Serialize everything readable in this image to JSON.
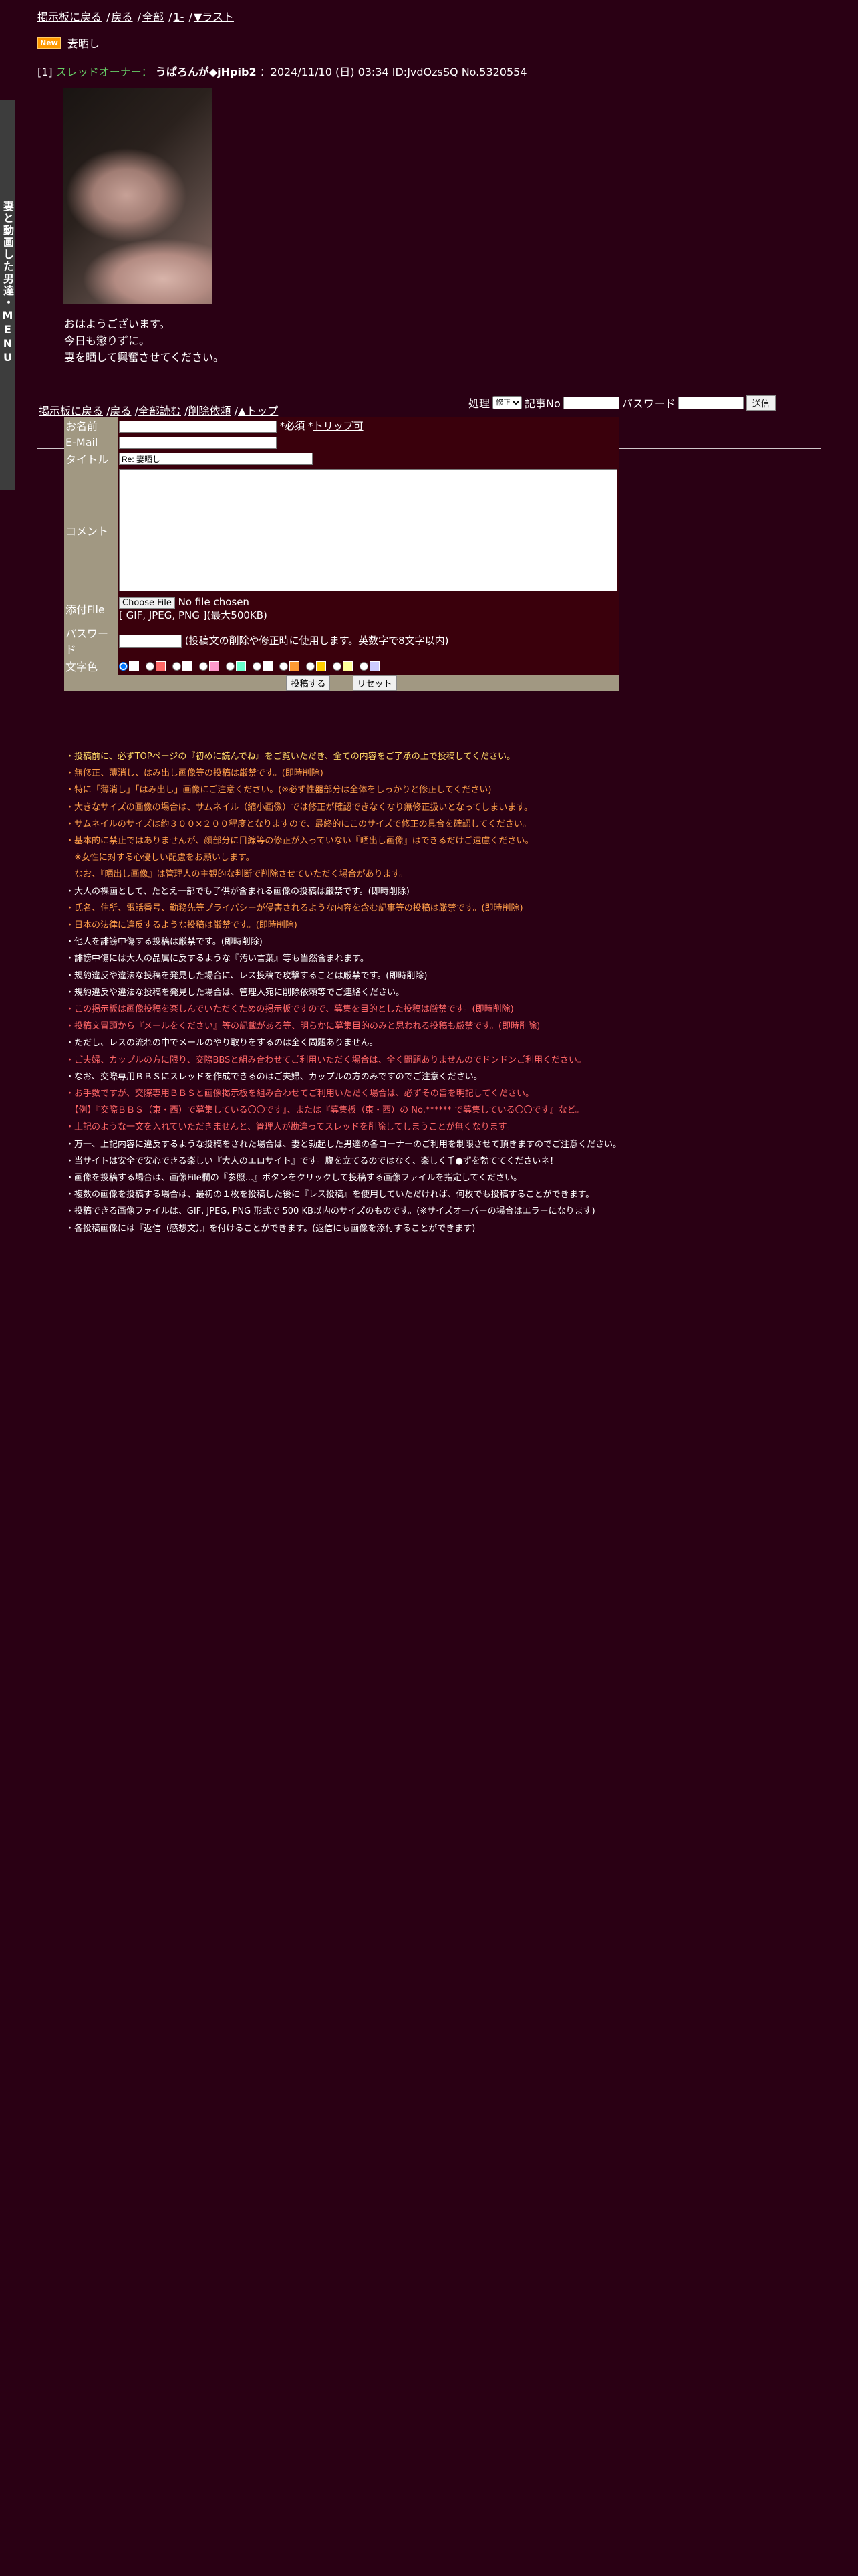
{
  "side_menu": {
    "label": "妻と動画した男達・MENU"
  },
  "topnav": {
    "back_board": "掲示板に戻る",
    "back": "戻る",
    "all": "全部",
    "first": "1-",
    "last": "▼ラスト"
  },
  "thread": {
    "new_badge": "New",
    "title": "妻晒し"
  },
  "post": {
    "number": "[1]",
    "owner_label": "スレッドオーナー：",
    "name": "うぱろんが◆jHpib2",
    "meta": "：2024/11/10 (日) 03:34 ID:JvdOzsSQ No.5320554",
    "body": [
      "おはようございます。",
      "今日も懲りずに。",
      "妻を晒して興奮させてください。"
    ]
  },
  "bottomnav": {
    "back_board": "掲示板に戻る",
    "back": "戻る",
    "read_all": "全部読む",
    "delete_request": "削除依頼",
    "top": "▲トップ"
  },
  "edit_form": {
    "action_label": "処理",
    "action_value": "修正",
    "article_no_label": "記事No",
    "password_label": "パスワード",
    "submit": "送信"
  },
  "post_form": {
    "name_label": "お名前",
    "name_note": "*必須 *",
    "trip_link": "トリップ可",
    "email_label": "E-Mail",
    "title_label": "タイトル",
    "title_value": "Re: 妻晒し",
    "comment_label": "コメント",
    "file_label": "添付File",
    "file_button": "Choose File",
    "file_status": "No file chosen",
    "file_note": "[ GIF, JPEG, PNG ](最大500KB)",
    "password_label": "パスワード",
    "password_note": "(投稿文の削除や修正時に使用します。英数字で8文字以内)",
    "color_label": "文字色",
    "colors": [
      "#ffffff",
      "#ff6666",
      "#ffffff",
      "#ff99cc",
      "#66ffcc",
      "#ffffff",
      "#ff9933",
      "#ffcc00",
      "#ffff99",
      "#ccccff"
    ],
    "submit": "投稿する",
    "reset": "リセット"
  },
  "notes": [
    {
      "c": "y",
      "t": "・投稿前に、必ずTOPページの『初めに読んでね』をご覧いただき、全ての内容をご了承の上で投稿してください。"
    },
    {
      "c": "o",
      "t": "・無修正、薄消し、はみ出し画像等の投稿は厳禁です。(即時削除)"
    },
    {
      "c": "o",
      "t": "・特に「薄消し」「はみ出し」画像にご注意ください。(※必ず性器部分は全体をしっかりと修正してください)"
    },
    {
      "c": "o",
      "t": "・大きなサイズの画像の場合は、サムネイル（縮小画像）では修正が確認できなくなり無修正扱いとなってしまいます。"
    },
    {
      "c": "o",
      "t": "・サムネイルのサイズは約３００×２００程度となりますので、最終的にこのサイズで修正の具合を確認してください。"
    },
    {
      "c": "o",
      "t": "・基本的に禁止ではありませんが、顔部分に目線等の修正が入っていない『晒出し画像』はできるだけご遠慮ください。"
    },
    {
      "c": "o",
      "t": "　※女性に対する心優しい配慮をお願いします。"
    },
    {
      "c": "o",
      "t": "　なお、『晒出し画像』は管理人の主観的な判断で削除させていただく場合があります。"
    },
    {
      "c": "w",
      "t": "・大人の裸画として、たとえ一部でも子供が含まれる画像の投稿は厳禁です。(即時削除)"
    },
    {
      "c": "o",
      "t": "・氏名、住所、電話番号、勤務先等プライバシーが侵害されるような内容を含む記事等の投稿は厳禁です。(即時削除)"
    },
    {
      "c": "o",
      "t": "・日本の法律に違反するような投稿は厳禁です。(即時削除)"
    },
    {
      "c": "w",
      "t": "・他人を誹謗中傷する投稿は厳禁です。(即時削除)"
    },
    {
      "c": "w",
      "t": "・誹謗中傷には大人の品属に反するような『汚い言葉』等も当然含まれます。"
    },
    {
      "c": "w",
      "t": "・規約違反や違法な投稿を発見した場合に、レス投稿で攻撃することは厳禁です。(即時削除)"
    },
    {
      "c": "w",
      "t": "・規約違反や違法な投稿を発見した場合は、管理人宛に削除依頼等でご連絡ください。"
    },
    {
      "c": "r",
      "t": "・この掲示板は画像投稿を楽しんでいただくための掲示板ですので、募集を目的とした投稿は厳禁です。(即時削除)"
    },
    {
      "c": "r",
      "t": "・投稿文冒頭から『メールをください』等の記載がある等、明らかに募集目的のみと思われる投稿も厳禁です。(即時削除)"
    },
    {
      "c": "w",
      "t": "・ただし、レスの流れの中でメールのやり取りをするのは全く問題ありません。"
    },
    {
      "c": "r",
      "t": "・ご夫婦、カップルの方に限り、交際BBSと組み合わせてご利用いただく場合は、全く問題ありませんのでドンドンご利用ください。"
    },
    {
      "c": "w",
      "t": "・なお、交際専用ＢＢＳにスレッドを作成できるのはご夫婦、カップルの方のみですのでご注意ください。"
    },
    {
      "c": "r",
      "t": "・お手数ですが、交際専用ＢＢＳと画像掲示板を組み合わせてご利用いただく場合は、必ずその旨を明記してください。"
    },
    {
      "c": "r",
      "t": "　【例】『交際ＢＢＳ（東・西）で募集している〇〇です』、または『募集板（東・西）の No.****** で募集している〇〇です』など。"
    },
    {
      "c": "r",
      "t": "・上記のような一文を入れていただきませんと、管理人が勘違ってスレッドを削除してしまうことが無くなります。"
    },
    {
      "c": "w",
      "t": "・万一、上記内容に違反するような投稿をされた場合は、妻と勃起した男達の各コーナーのご利用を制限させて頂きますのでご注意ください。"
    },
    {
      "c": "w",
      "t": "・当サイトは安全で安心できる楽しい『大人のエロサイト』です。腹を立てるのではなく、楽しく千●ずを勃ててくださいネ！"
    },
    {
      "c": "w",
      "t": "・画像を投稿する場合は、画像File欄の『参照...』ボタンをクリックして投稿する画像ファイルを指定してください。"
    },
    {
      "c": "w",
      "t": "・複数の画像を投稿する場合は、最初の１枚を投稿した後に『レス投稿』を使用していただければ、何枚でも投稿することができます。"
    },
    {
      "c": "w",
      "t": "・投稿できる画像ファイルは、GIF, JPEG, PNG 形式で 500 KB以内のサイズのものです。(※サイズオーバーの場合はエラーになります)"
    },
    {
      "c": "w",
      "t": "・各投稿画像には『返信（感想文）』を付けることができます。(返信にも画像を添付することができます)"
    }
  ]
}
